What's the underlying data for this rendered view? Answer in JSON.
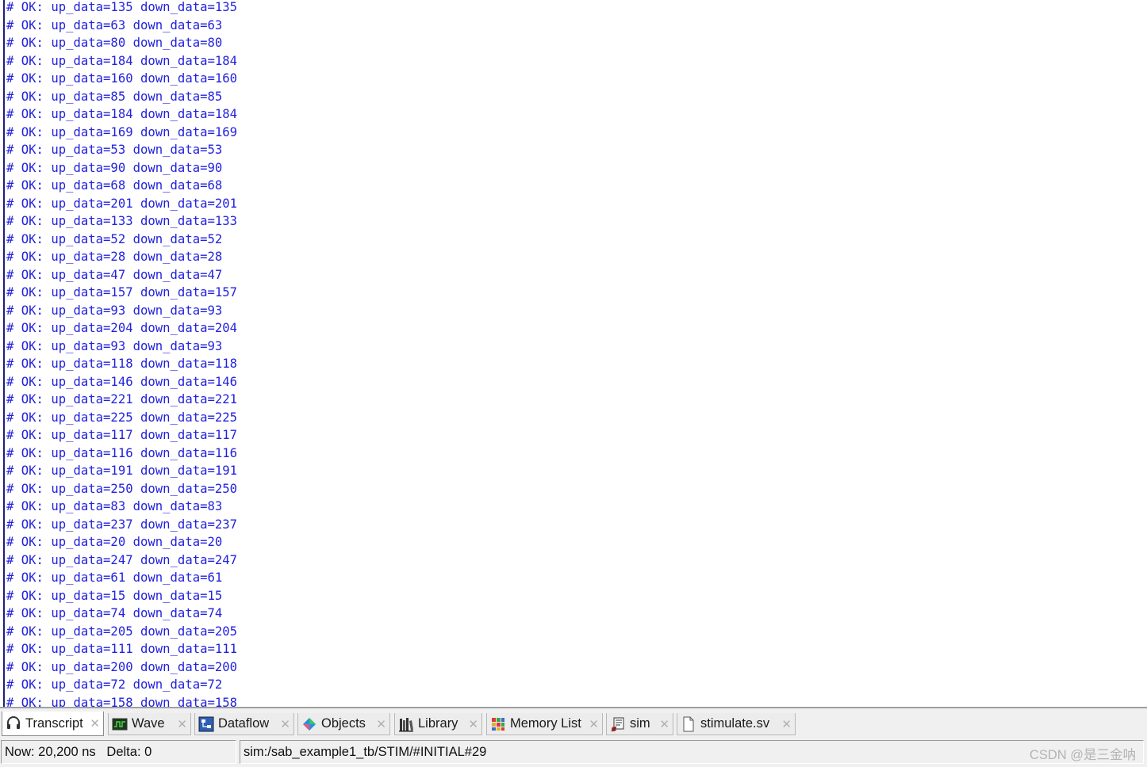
{
  "transcript": {
    "lines": [
      "# OK: up_data=135 down_data=135",
      "# OK: up_data=63 down_data=63",
      "# OK: up_data=80 down_data=80",
      "# OK: up_data=184 down_data=184",
      "# OK: up_data=160 down_data=160",
      "# OK: up_data=85 down_data=85",
      "# OK: up_data=184 down_data=184",
      "# OK: up_data=169 down_data=169",
      "# OK: up_data=53 down_data=53",
      "# OK: up_data=90 down_data=90",
      "# OK: up_data=68 down_data=68",
      "# OK: up_data=201 down_data=201",
      "# OK: up_data=133 down_data=133",
      "# OK: up_data=52 down_data=52",
      "# OK: up_data=28 down_data=28",
      "# OK: up_data=47 down_data=47",
      "# OK: up_data=157 down_data=157",
      "# OK: up_data=93 down_data=93",
      "# OK: up_data=204 down_data=204",
      "# OK: up_data=93 down_data=93",
      "# OK: up_data=118 down_data=118",
      "# OK: up_data=146 down_data=146",
      "# OK: up_data=221 down_data=221",
      "# OK: up_data=225 down_data=225",
      "# OK: up_data=117 down_data=117",
      "# OK: up_data=116 down_data=116",
      "# OK: up_data=191 down_data=191",
      "# OK: up_data=250 down_data=250",
      "# OK: up_data=83 down_data=83",
      "# OK: up_data=237 down_data=237",
      "# OK: up_data=20 down_data=20",
      "# OK: up_data=247 down_data=247",
      "# OK: up_data=61 down_data=61",
      "# OK: up_data=15 down_data=15",
      "# OK: up_data=74 down_data=74",
      "# OK: up_data=205 down_data=205",
      "# OK: up_data=111 down_data=111",
      "# OK: up_data=200 down_data=200",
      "# OK: up_data=72 down_data=72",
      "# OK: up_data=158 down_data=158"
    ]
  },
  "tabs": [
    {
      "id": "transcript",
      "label": "Transcript",
      "icon": "transcript-icon",
      "active": true
    },
    {
      "id": "wave",
      "label": "Wave",
      "icon": "wave-icon",
      "active": false
    },
    {
      "id": "dataflow",
      "label": "Dataflow",
      "icon": "dataflow-icon",
      "active": false
    },
    {
      "id": "objects",
      "label": "Objects",
      "icon": "objects-icon",
      "active": false
    },
    {
      "id": "library",
      "label": "Library",
      "icon": "library-icon",
      "active": false
    },
    {
      "id": "memory-list",
      "label": "Memory List",
      "icon": "memory-list-icon",
      "active": false
    },
    {
      "id": "sim",
      "label": "sim",
      "icon": "sim-icon",
      "active": false
    },
    {
      "id": "stimulate-sv",
      "label": "stimulate.sv",
      "icon": "file-icon",
      "active": false
    }
  ],
  "status": {
    "now": "Now: 20,200 ns",
    "delta": "Delta: 0",
    "path": "sim:/sab_example1_tb/STIM/#INITIAL#29"
  },
  "watermark": "CSDN @是三金呐",
  "colors": {
    "transcript_text": "#2222dd",
    "tab_bar_bg": "#f0f0f0"
  }
}
